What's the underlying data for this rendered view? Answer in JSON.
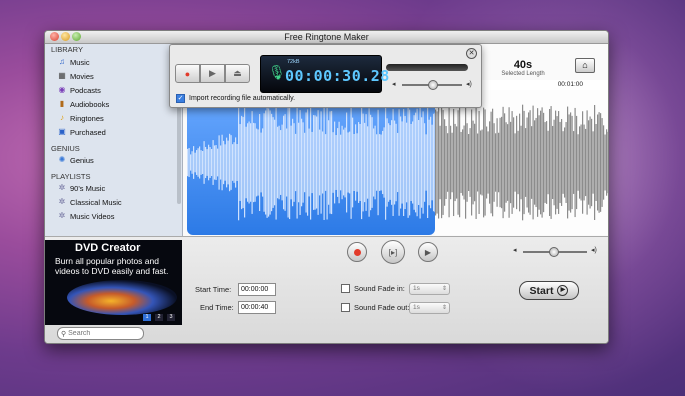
{
  "window": {
    "title": "Free Ringtone Maker"
  },
  "sidebar": {
    "sections": [
      {
        "header": "LIBRARY",
        "items": [
          {
            "label": "Music",
            "icon": "music-note-icon"
          },
          {
            "label": "Movies",
            "icon": "film-icon"
          },
          {
            "label": "Podcasts",
            "icon": "podcast-icon"
          },
          {
            "label": "Audiobooks",
            "icon": "book-icon"
          },
          {
            "label": "Ringtones",
            "icon": "bell-icon"
          },
          {
            "label": "Purchased",
            "icon": "bag-icon"
          }
        ]
      },
      {
        "header": "GENIUS",
        "items": [
          {
            "label": "Genius",
            "icon": "atom-icon"
          }
        ]
      },
      {
        "header": "PLAYLISTS",
        "items": [
          {
            "label": "90's Music",
            "icon": "gear-playlist-icon"
          },
          {
            "label": "Classical Music",
            "icon": "gear-playlist-icon"
          },
          {
            "label": "Music Videos",
            "icon": "gear-playlist-icon"
          }
        ]
      }
    ]
  },
  "selection": {
    "length": "40s",
    "length_label": "Selected Length"
  },
  "ruler": {
    "time_label": "00:01:00"
  },
  "recorder": {
    "size_label": "72kB",
    "time": "00:00:30.28",
    "import_label": "Import recording file automatically.",
    "import_checked": true
  },
  "ad": {
    "title": "DVD Creator",
    "line1": "Burn all popular photos and",
    "line2": "videos to DVD easily and fast.",
    "pages": [
      "1",
      "2",
      "3"
    ]
  },
  "times": {
    "start_label": "Start Time:",
    "start_value": "00:00:00",
    "end_label": "End Time:",
    "end_value": "00:00:40"
  },
  "fade": {
    "in_label": "Sound Fade in:",
    "in_value": "1s",
    "out_label": "Sound Fade out:",
    "out_value": "1s"
  },
  "start_button": {
    "label": "Start"
  },
  "search": {
    "placeholder": "Search"
  },
  "colors": {
    "selection_blue": "#2c7ae6",
    "record_red": "#e23a2a",
    "lcd_text": "#5ec8ff"
  }
}
